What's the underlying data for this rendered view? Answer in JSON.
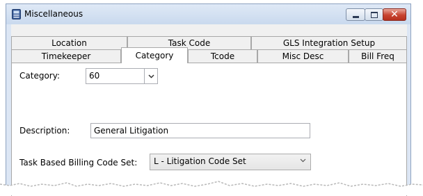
{
  "window": {
    "title": "Miscellaneous"
  },
  "tabs": {
    "back_row": [
      {
        "label": "Location"
      },
      {
        "label": "Task Code"
      },
      {
        "label": "GLS Integration Setup"
      }
    ],
    "front_row": [
      {
        "label": "Timekeeper"
      },
      {
        "label": "Category"
      },
      {
        "label": "Tcode"
      },
      {
        "label": "Misc Desc"
      },
      {
        "label": "Bill Freq"
      }
    ],
    "selected": "Category"
  },
  "form": {
    "category_label": "Category:",
    "category_value": "60",
    "description_label": "Description:",
    "description_value": "General Litigation",
    "task_code_set_label": "Task Based Billing Code Set:",
    "task_code_set_value": "L - Litigation Code Set"
  },
  "icons": {
    "app": "app-icon",
    "minimize": "minimize-icon",
    "maximize": "maximize-icon",
    "close": "close-icon",
    "dropdown": "chevron-down-icon"
  }
}
